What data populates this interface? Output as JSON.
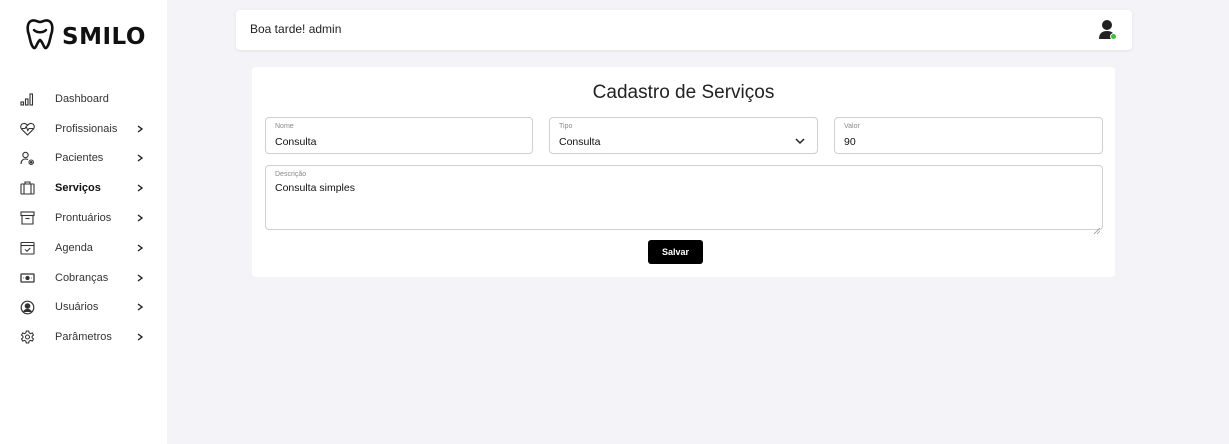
{
  "brand": {
    "name": "SMILO",
    "icon": "tooth-icon"
  },
  "sidebar": {
    "items": [
      {
        "label": "Dashboard",
        "icon": "bar-chart-icon",
        "has_chevron": false,
        "active": false
      },
      {
        "label": "Profissionais",
        "icon": "heart-pulse-icon",
        "has_chevron": true,
        "active": false
      },
      {
        "label": "Pacientes",
        "icon": "user-settings-icon",
        "has_chevron": true,
        "active": false
      },
      {
        "label": "Serviços",
        "icon": "briefcase-icon",
        "has_chevron": true,
        "active": true
      },
      {
        "label": "Prontuários",
        "icon": "archive-icon",
        "has_chevron": true,
        "active": false
      },
      {
        "label": "Agenda",
        "icon": "calendar-check-icon",
        "has_chevron": true,
        "active": false
      },
      {
        "label": "Cobranças",
        "icon": "money-icon",
        "has_chevron": true,
        "active": false
      },
      {
        "label": "Usuários",
        "icon": "user-circle-icon",
        "has_chevron": true,
        "active": false
      },
      {
        "label": "Parâmetros",
        "icon": "gear-icon",
        "has_chevron": true,
        "active": false
      }
    ]
  },
  "header": {
    "greeting": "Boa tarde! admin",
    "user_status_color": "#3dbb3d"
  },
  "form": {
    "title": "Cadastro de Serviços",
    "nome": {
      "label": "Nome",
      "value": "Consulta"
    },
    "tipo": {
      "label": "Tipo",
      "value": "Consulta"
    },
    "valor": {
      "label": "Valor",
      "value": "90"
    },
    "descricao": {
      "label": "Descrição",
      "value": "Consulta simples"
    },
    "save_label": "Salvar"
  },
  "colors": {
    "background": "#f4f3f7",
    "button": "#000000",
    "accent_status": "#3dbb3d"
  }
}
